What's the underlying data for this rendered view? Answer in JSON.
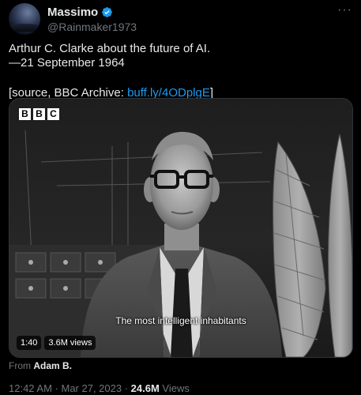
{
  "author": {
    "name": "Massimo",
    "handle": "@Rainmaker1973",
    "verified_color": "#1d9bf0"
  },
  "more_icon": "more-horizontal-icon",
  "tweet": {
    "line1": "Arthur C. Clarke about the future of AI.",
    "line2": "—21 September 1964",
    "source_prefix": "[source, BBC Archive: ",
    "source_link": "buff.ly/4ODplgE",
    "source_suffix": "]"
  },
  "video": {
    "logo_letters": [
      "B",
      "B",
      "C"
    ],
    "caption": "The most intelligent inhabitants",
    "duration": "1:40",
    "views": "3.6M views"
  },
  "attribution": {
    "prefix": "From ",
    "name": "Adam B."
  },
  "meta": {
    "time": "12:42 AM",
    "separator": " · ",
    "date": "Mar 27, 2023",
    "views_count": "24.6M",
    "views_label": " Views"
  }
}
